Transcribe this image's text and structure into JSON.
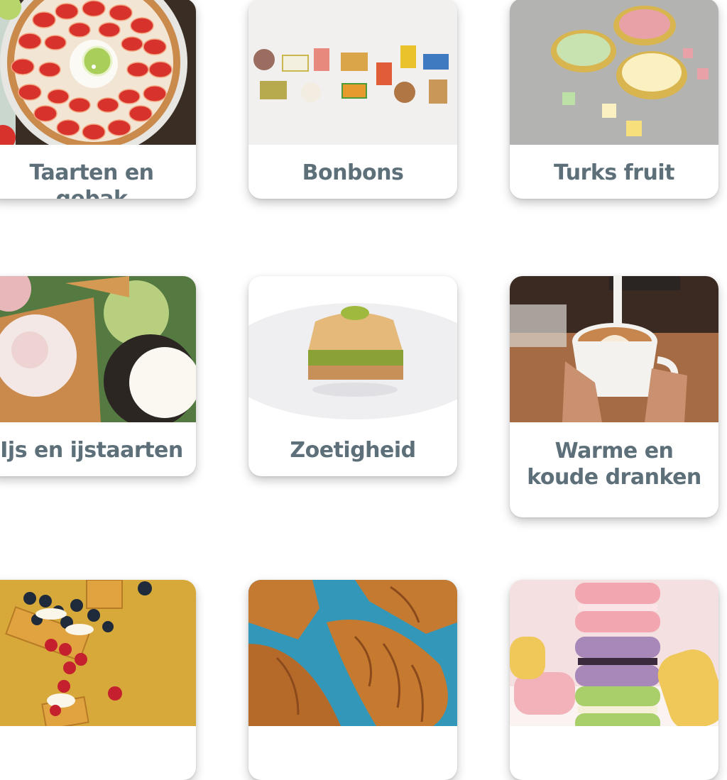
{
  "categories": [
    {
      "label": "Taarten en gebak",
      "image": "strawberry-tart-image"
    },
    {
      "label": "Bonbons",
      "image": "bonbons-image"
    },
    {
      "label": "Turks fruit",
      "image": "turkish-delight-image"
    },
    {
      "label": "Ijs en ijstaarten",
      "image": "ice-cream-image"
    },
    {
      "label": "Zoetigheid",
      "image": "baklava-image"
    },
    {
      "label": "Warme en koude dranken",
      "image": "coffee-image"
    },
    {
      "label": "",
      "image": "waffle-berries-image"
    },
    {
      "label": "",
      "image": "croissants-image"
    },
    {
      "label": "",
      "image": "macarons-image"
    }
  ],
  "colors": {
    "label": "#5d6f79",
    "card_bg": "#ffffff"
  }
}
